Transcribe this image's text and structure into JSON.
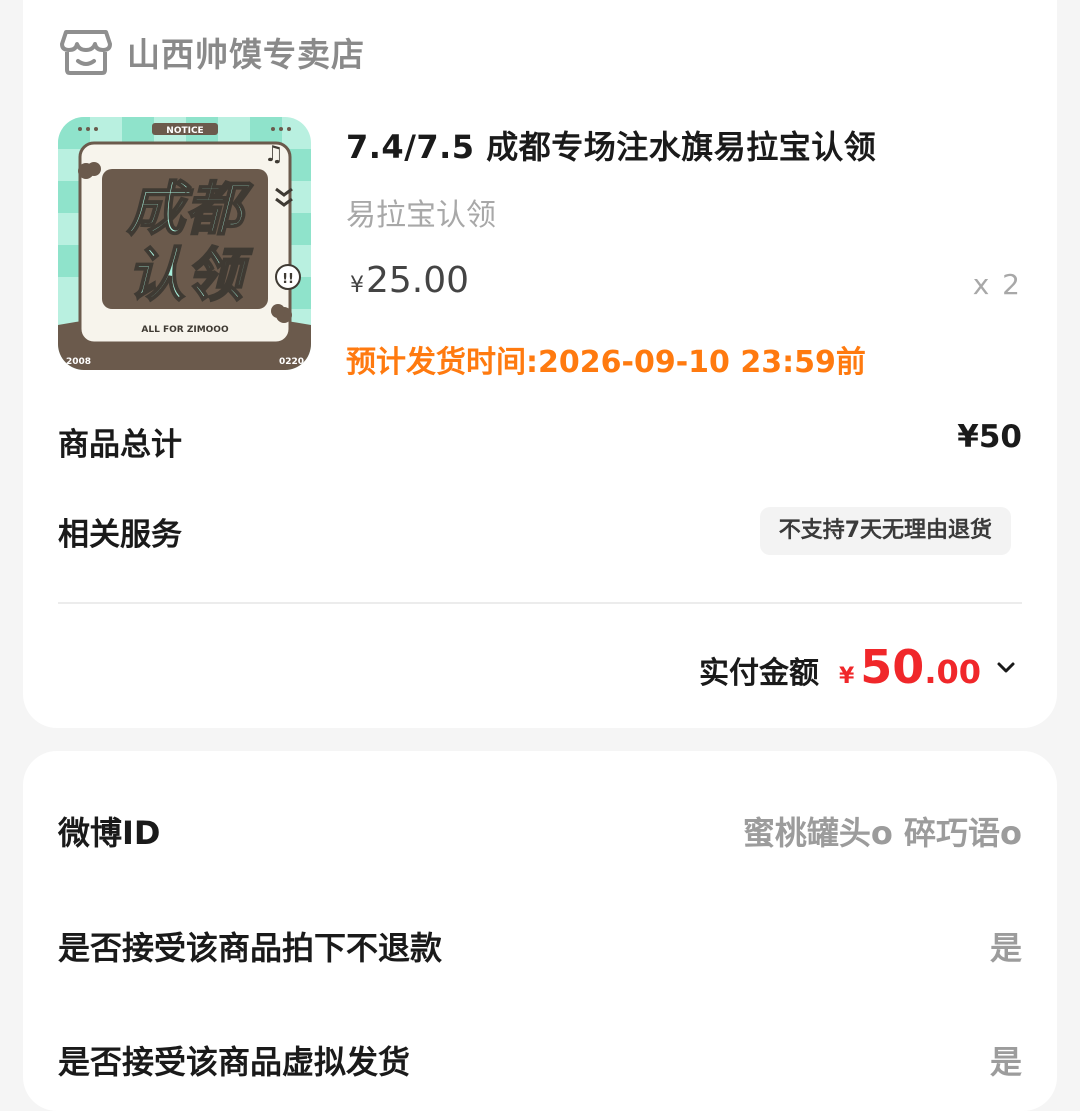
{
  "shop": {
    "name": "山西帅馍专卖店",
    "icon": "store-icon"
  },
  "product": {
    "title": "7.4/7.5  成都专场注水旗易拉宝认领",
    "spec": "易拉宝认领",
    "currency": "¥",
    "price": "25.00",
    "quantity": "x 2",
    "ship_time": "预计发货时间:2026-09-10  23:59前",
    "image": {
      "notice_text": "NOTICE",
      "line1": "成都",
      "line2": "认领",
      "footer_text": "ALL FOR ZIMOOO",
      "left_num": "2008",
      "right_num": "0220",
      "colors": {
        "mint": "#9ee8d3",
        "brown": "#6b5a4c",
        "cream": "#f7f4ec"
      }
    }
  },
  "summary": {
    "total_label": "商品总计",
    "total_value": "¥50",
    "service_label": "相关服务",
    "service_badge": "不支持7天无理由退货",
    "paid_label": "实付金额",
    "paid_currency": "¥",
    "paid_int": "50",
    "paid_dec": ".00",
    "expand_icon": "chevron-down-icon"
  },
  "form": {
    "rows": [
      {
        "label": "微博ID",
        "value": "蜜桃罐头o  碎巧语o"
      },
      {
        "label": "是否接受该商品拍下不退款",
        "value": "是"
      },
      {
        "label": "是否接受该商品虚拟发货",
        "value": "是"
      }
    ]
  },
  "colors": {
    "accent_red": "#f0272a",
    "ship_orange": "#ff7a0f",
    "muted_gray": "#a8a8a8",
    "page_bg": "#f5f5f5"
  }
}
